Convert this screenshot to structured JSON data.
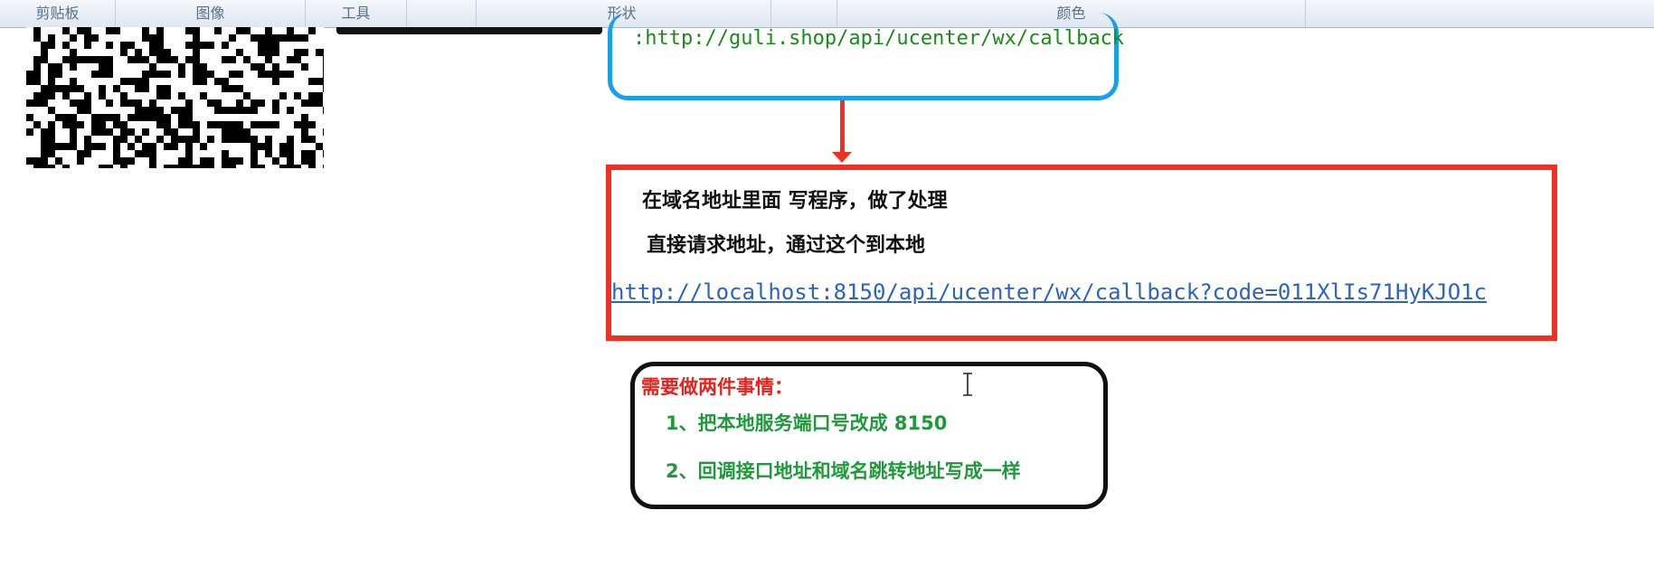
{
  "ribbon": {
    "groups": [
      "剪贴板",
      "图像",
      "工具",
      "形状",
      "颜色"
    ]
  },
  "callback_box": {
    "url": ":http://guli.shop/api/ucenter/wx/callback"
  },
  "process_box": {
    "line1": "在域名地址里面 写程序，做了处理",
    "line2": "直接请求地址，通过这个到本地",
    "url": "http://localhost:8150/api/ucenter/wx/callback?code=011XlIs71HyKJO1c"
  },
  "todo_box": {
    "title": "需要做两件事情：",
    "items": [
      "1、把本地服务端口号改成 8150",
      "2、回调接口地址和域名跳转地址写成一样"
    ]
  },
  "colors": {
    "blue": "#1aa0e6",
    "red": "#ee3124",
    "green": "#1f9a3a"
  }
}
